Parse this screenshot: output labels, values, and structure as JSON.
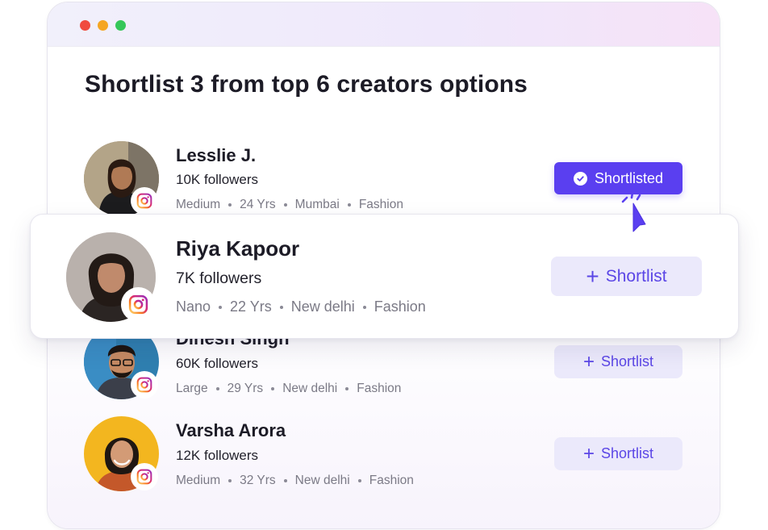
{
  "window": {
    "controls": [
      "close",
      "minimize",
      "maximize"
    ]
  },
  "heading": "Shortlist 3 from top 6 creators options",
  "creators": [
    {
      "name": "Lesslie J.",
      "followers": "10K followers",
      "tier": "Medium",
      "age": "24 Yrs",
      "city": "Mumbai",
      "category": "Fashion",
      "platform_icon": "instagram-icon",
      "action": {
        "label": "Shortlisted",
        "state": "selected",
        "icon": "check-circle-icon"
      }
    },
    {
      "name": "Riya Kapoor",
      "followers": "7K followers",
      "tier": "Nano",
      "age": "22 Yrs",
      "city": "New delhi",
      "category": "Fashion",
      "platform_icon": "instagram-icon",
      "action": {
        "label": "Shortlist",
        "state": "default",
        "icon": "plus-icon"
      }
    },
    {
      "name": "Dinesh Singh",
      "followers": "60K followers",
      "tier": "Large",
      "age": "29 Yrs",
      "city": "New delhi",
      "category": "Fashion",
      "platform_icon": "instagram-icon",
      "action": {
        "label": "Shortlist",
        "state": "default",
        "icon": "plus-icon"
      }
    },
    {
      "name": "Varsha Arora",
      "followers": "12K followers",
      "tier": "Medium",
      "age": "32 Yrs",
      "city": "New delhi",
      "category": "Fashion",
      "platform_icon": "instagram-icon",
      "action": {
        "label": "Shortlist",
        "state": "default",
        "icon": "plus-icon"
      }
    }
  ],
  "colors": {
    "accent": "#5a3ff0",
    "accent_soft": "#ebe9fb",
    "accent_text": "#5b46e6",
    "heading": "#1c1b26",
    "meta_text": "#7b7a86"
  }
}
